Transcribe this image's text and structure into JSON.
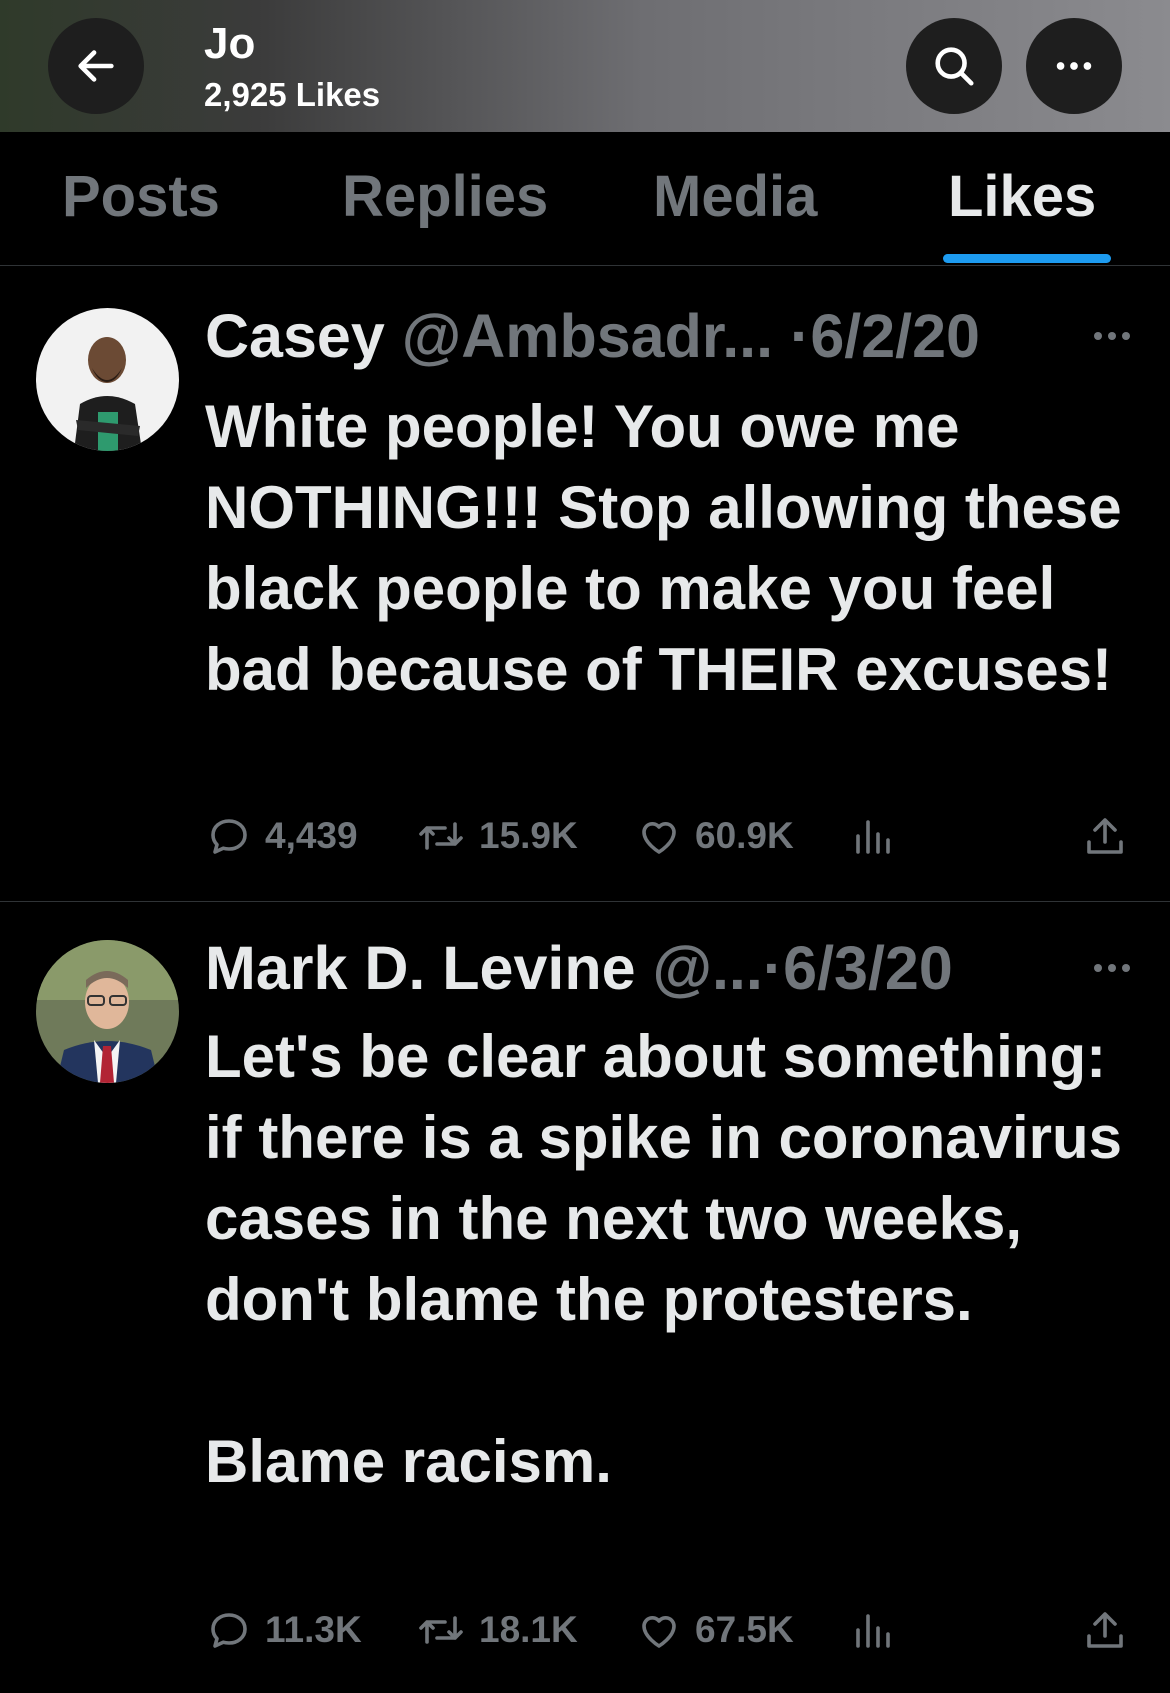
{
  "header": {
    "title": "Jo",
    "subtitle": "2,925 Likes",
    "back_icon": "arrow-left-icon",
    "search_icon": "search-icon",
    "more_icon": "more-horizontal-icon"
  },
  "tabs": [
    {
      "label": "Posts",
      "active": false
    },
    {
      "label": "Replies",
      "active": false
    },
    {
      "label": "Media",
      "active": false
    },
    {
      "label": "Likes",
      "active": true
    }
  ],
  "posts": [
    {
      "name": "Casey",
      "handle": "@Ambsadr...",
      "separator": "·",
      "date": "6/2/20",
      "body": [
        "White people! You owe me NOTHING!!! Stop allowing these black people to make you feel bad because of THEIR excuses!"
      ],
      "replies": "4,439",
      "reposts": "15.9K",
      "likes": "60.9K"
    },
    {
      "name": "Mark D. Levine",
      "handle": "@...",
      "separator": "·",
      "date": "6/3/20",
      "body": [
        "Let's be clear about something: if there is a spike in coronavirus cases in the next two weeks, don't blame the protesters.",
        "Blame racism."
      ],
      "replies": "11.3K",
      "reposts": "18.1K",
      "likes": "67.5K"
    }
  ],
  "colors": {
    "background": "#000000",
    "text": "#e7e9ea",
    "muted": "#71767b",
    "accent": "#1d9bf0",
    "divider": "#2f3336"
  }
}
